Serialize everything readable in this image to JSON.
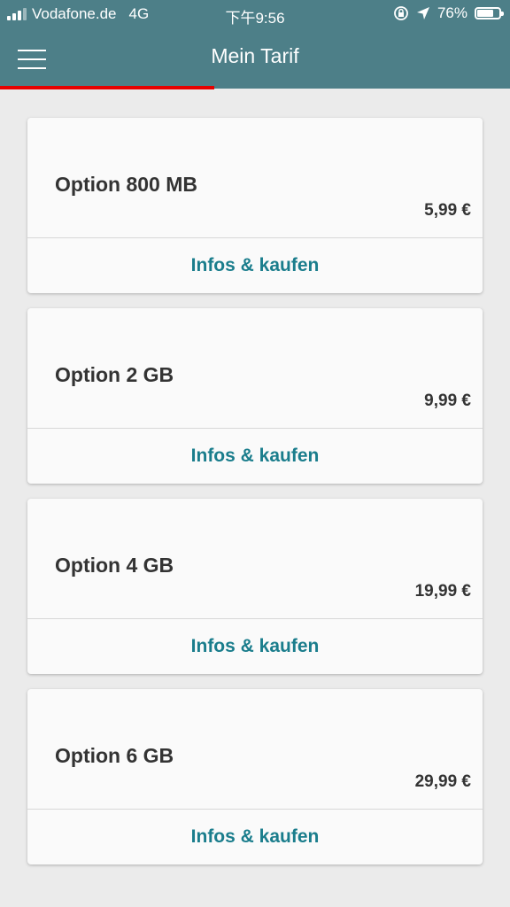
{
  "status_bar": {
    "carrier": "Vodafone.de",
    "network": "4G",
    "time": "下午9:56",
    "battery_percent": "76%",
    "battery_level": 0.76,
    "icons": [
      "signal-icon",
      "rotation-lock-icon",
      "location-arrow-icon",
      "battery-icon"
    ]
  },
  "header": {
    "title": "Mein Tarif",
    "menu_icon": "hamburger-menu-icon"
  },
  "colors": {
    "header_bg": "#4d7f88",
    "accent_red": "#e60000",
    "link": "#1a7d8c",
    "background": "#ebebeb"
  },
  "options": [
    {
      "name": "Option 800 MB",
      "price": "5,99 €",
      "action": "Infos & kaufen"
    },
    {
      "name": "Option 2 GB",
      "price": "9,99 €",
      "action": "Infos & kaufen"
    },
    {
      "name": "Option 4 GB",
      "price": "19,99 €",
      "action": "Infos & kaufen"
    },
    {
      "name": "Option 6 GB",
      "price": "29,99 €",
      "action": "Infos & kaufen"
    }
  ]
}
